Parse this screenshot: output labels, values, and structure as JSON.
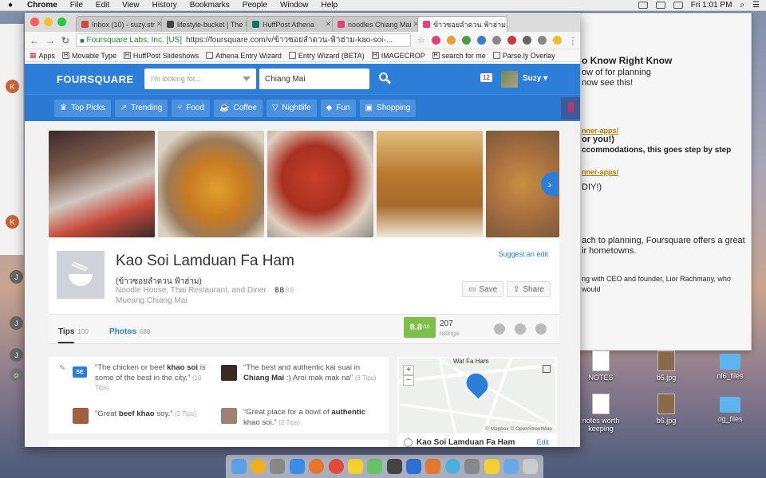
{
  "menubar": {
    "app": "Chrome",
    "items": [
      "File",
      "Edit",
      "View",
      "History",
      "Bookmarks",
      "People",
      "Window",
      "Help"
    ],
    "clock": "Fri 1:01 PM"
  },
  "background_doc": {
    "title": "o Know Right Know",
    "lines": [
      "ow of for planning",
      "now see this!"
    ],
    "link1": "nner-apps/",
    "line3": "or you!)",
    "line4": "ccommodations, this goes step by step",
    "link2": "nner-apps/",
    "line5": "DIY!)",
    "line6": "ach to planning, Foursquare offers a great",
    "line7": "ir hometowns.",
    "line8": "ng with CEO and founder, Lior Rachmany, who would"
  },
  "desktop_icons": [
    {
      "label": "NOTES",
      "kind": "doc"
    },
    {
      "label": "b5.jpg",
      "kind": "img"
    },
    {
      "label": "nl6_files",
      "kind": "folder"
    },
    {
      "label": "notes worth keeping",
      "kind": "doc"
    },
    {
      "label": "b6.jpg",
      "kind": "img"
    },
    {
      "label": "og_files",
      "kind": "folder"
    }
  ],
  "tabs": [
    {
      "title": "Inbox (10) - suzy.str",
      "color": "#d44638",
      "active": false
    },
    {
      "title": "lifestyle-bucket | The",
      "color": "#444444",
      "active": false
    },
    {
      "title": "HuffPost Athena",
      "color": "#0b7a5a",
      "active": false
    },
    {
      "title": "noodles Chiang Mai",
      "color": "#e0427a",
      "active": false
    },
    {
      "title": "ข้าวซอยลำดวน ฟ้าฮ่าม",
      "color": "#e0427a",
      "active": true
    }
  ],
  "toolbar": {
    "secure_label": "Foursquare Labs, Inc. [US]",
    "url": "https://foursquare.com/v/ข้าวซอยลำดวน-ฟ้าฮ่าม-kao-soi-..."
  },
  "bookmarks": [
    "Apps",
    "Movable Type",
    "HuffPost Slideshows",
    "Athena Entry Wizard",
    "Entry Wizard (BETA)",
    "IMAGECROP",
    "search for me",
    "Parse.ly Overlay"
  ],
  "fs": {
    "logo": "FOURSQUARE",
    "search_placeholder": "I'm looking for...",
    "near_value": "Chiang Mai",
    "notifications": "12",
    "user": "Suzy",
    "categories": [
      "Top Picks",
      "Trending",
      "Food",
      "Coffee",
      "Nightlife",
      "Fun",
      "Shopping"
    ]
  },
  "venue": {
    "name": "Kao Soi Lamduan Fa Ham",
    "alt_name": "(ข้าวซอยลำดวน ฟ้าฮ่าม)",
    "categories": "Noodle House, Thai Restaurant, and Diner",
    "price_on": "฿฿",
    "price_off": "฿฿",
    "location": "Mueang Chiang Mai",
    "suggest_edit": "Suggest an edit",
    "save": "Save",
    "share": "Share"
  },
  "stats": {
    "tips_label": "Tips",
    "tips_count": "100",
    "photos_label": "Photos",
    "photos_count": "688",
    "rating": "8.8",
    "rating_scale": "/10",
    "rating_count": "207",
    "rating_label": "ratings"
  },
  "tips": [
    {
      "pre": "“The chicken or beef ",
      "bold": "khao soi",
      "post": " is some of the best in the city.”",
      "count": "(10 Tips)"
    },
    {
      "pre": "“The best and authentic kai suai in ",
      "bold": "Chiang Mai",
      "post": " :) Aroi mak mak na”",
      "count": "(3 Tips)"
    },
    {
      "pre": "“Great ",
      "bold": "beef khao",
      "post": " soy.”",
      "count": "(2 Tips)"
    },
    {
      "pre": "“Great place for a bowl of ",
      "bold": "authentic",
      "post": " khao soi.”",
      "count": "(2 Tips)"
    }
  ],
  "map": {
    "street_label": "Wat Fa Ham",
    "attribution": "© Mapbox © OpenStreetMap",
    "venue_name": "Kao Soi Lamduan Fa Ham",
    "edit": "Edit",
    "zoom_in": "+",
    "zoom_out": "−"
  },
  "colors": {
    "foursquare_blue": "#2d7ed8",
    "rating_green": "#7cc04a"
  }
}
